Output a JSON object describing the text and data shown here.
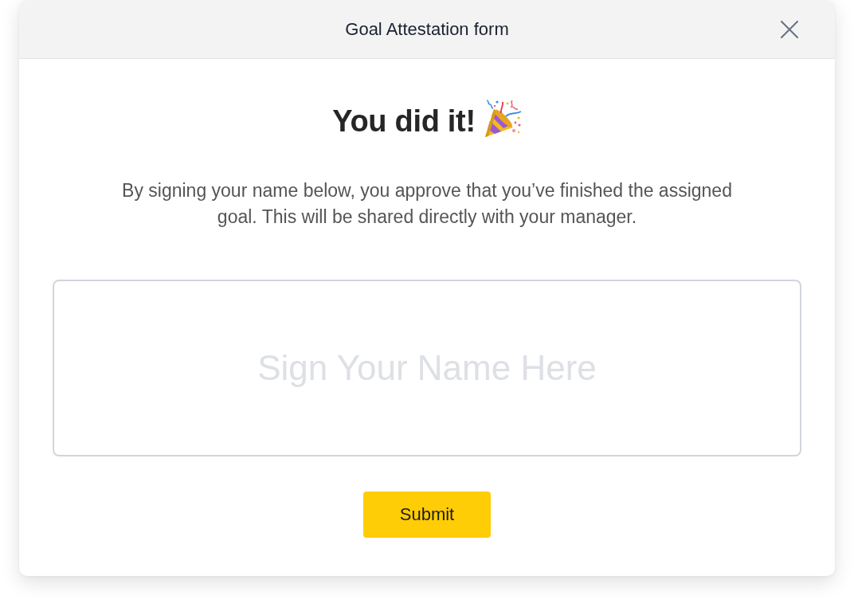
{
  "dialog": {
    "title": "Goal Attestation form",
    "heading": "You did it!",
    "message": "By signing your name below, you approve that you’ve finished the assigned goal. This will be shared directly with your manager.",
    "signature_field": {
      "placeholder": "Sign Your Name Here"
    },
    "buttons": [
      "Submit"
    ]
  }
}
